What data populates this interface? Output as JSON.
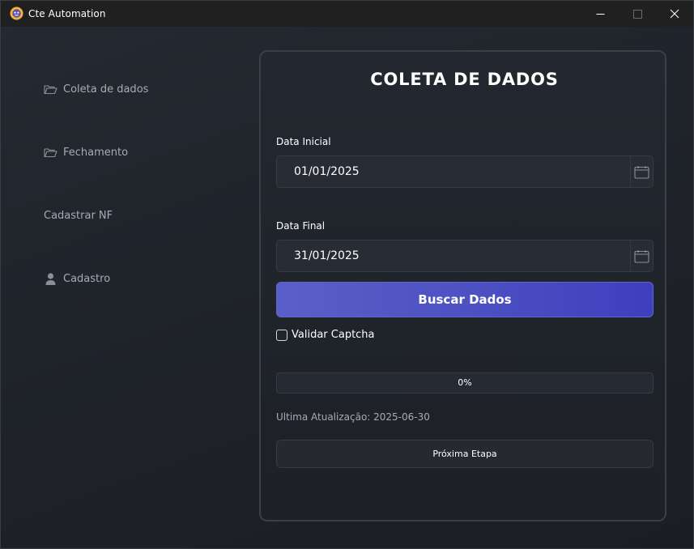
{
  "window": {
    "title": "Cte Automation"
  },
  "sidebar": {
    "items": [
      {
        "label": "Coleta de dados",
        "icon": "folder-open-icon"
      },
      {
        "label": "Fechamento",
        "icon": "folder-open-icon"
      },
      {
        "label": "Cadastrar NF",
        "icon": null
      },
      {
        "label": "Cadastro",
        "icon": "user-icon"
      }
    ]
  },
  "main": {
    "title": "COLETA DE DADOS",
    "start_date": {
      "label": "Data Inicial",
      "value": "01/01/2025",
      "icon": "calendar-icon"
    },
    "end_date": {
      "label": "Data Final",
      "value": "31/01/2025",
      "icon": "calendar-icon"
    },
    "search_button": "Buscar Dados",
    "captcha": {
      "label": "Validar Captcha",
      "checked": false
    },
    "progress": {
      "value": 0,
      "text": "0%"
    },
    "last_update": "Ultima Atualização: 2025-06-30",
    "next_button": "Próxima Etapa"
  },
  "colors": {
    "accent": "#4d51c2",
    "background": "#1f232a",
    "text_muted": "#a6acb6"
  }
}
